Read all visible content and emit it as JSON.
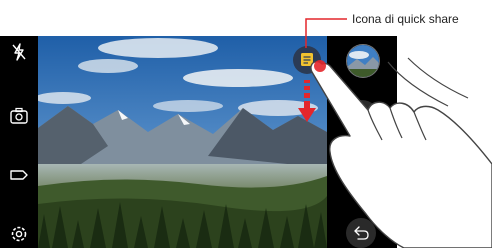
{
  "annotation": {
    "label": "Icona di quick share"
  },
  "camera": {
    "left_icons": [
      "flash-off-icon",
      "switch-camera-icon",
      "mode-icon",
      "settings-icon"
    ],
    "right_controls": [
      "gallery-thumbnail",
      "record-video-icon",
      "back-icon"
    ],
    "quick_share_icon": "quick-share-icon"
  },
  "colors": {
    "callout": "#e4262b",
    "quick_share_bg": "#2b3b55",
    "quick_share_icon": "#f2c330",
    "bars": "#000000"
  }
}
